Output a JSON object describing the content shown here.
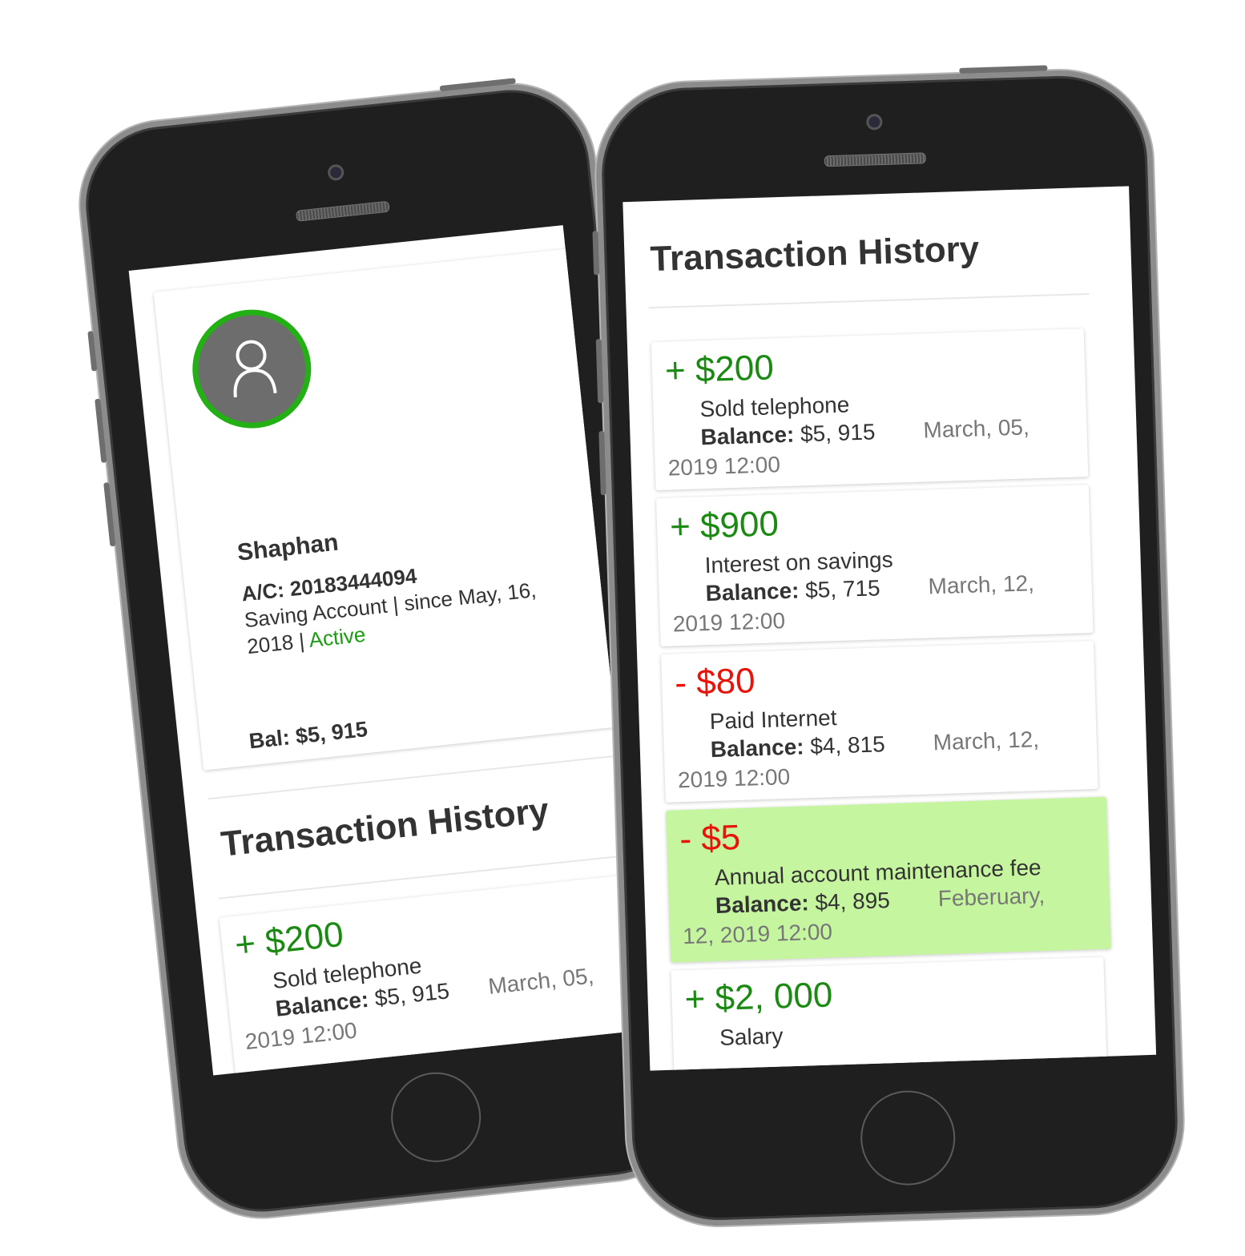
{
  "profile": {
    "name": "Shaphan",
    "account_label": "A/C:",
    "account_number": "20183444094",
    "account_details": "Saving Account | since May, 16, 2018 |",
    "status": "Active",
    "balance_text": "Bal: $5, 915",
    "avatar_icon": "user-icon"
  },
  "section_title": "Transaction History",
  "balance_label": "Balance:",
  "transactions": [
    {
      "amount": "+ $200",
      "type": "credit",
      "description": "Sold telephone",
      "balance": "$5, 915",
      "date_line1": "March, 05,",
      "date_line2": "2019 12:00",
      "highlighted": false
    },
    {
      "amount": "+ $900",
      "type": "credit",
      "description": "Interest on savings",
      "balance": "$5, 715",
      "date_line1": "March, 12,",
      "date_line2": "2019 12:00",
      "highlighted": false
    },
    {
      "amount": "- $80",
      "type": "debit",
      "description": "Paid Internet",
      "balance": "$4, 815",
      "date_line1": "March, 12,",
      "date_line2": "2019 12:00",
      "highlighted": false
    },
    {
      "amount": "- $5",
      "type": "debit",
      "description": "Annual account maintenance fee",
      "balance": "$4, 895",
      "date_line1": "Feberuary,",
      "date_line2": "12, 2019 12:00",
      "highlighted": true
    },
    {
      "amount": "+ $2, 000",
      "type": "credit",
      "description": "Salary",
      "balance": "",
      "date_line1": "",
      "date_line2": "",
      "highlighted": false
    }
  ],
  "colors": {
    "credit": "#1a8a12",
    "debit": "#e8140c",
    "active": "#1a9c10",
    "avatar_ring": "#22b014",
    "highlight_bg": "#c6f5a0"
  }
}
